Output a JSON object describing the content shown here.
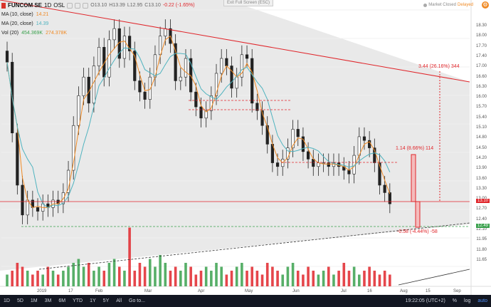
{
  "window": {
    "exit_fullscreen": "Exit Full Screen (ESC)"
  },
  "header": {
    "symbol": "FUNCOM SE",
    "interval": "1D",
    "exchange": "OSL",
    "ohlc": {
      "o_label": "O",
      "o": "13.10",
      "h_label": "H",
      "h": "13.39",
      "l_label": "L",
      "l": "12.95",
      "c_label": "C",
      "c": "13.10",
      "change": "-0.22 (-1.65%)"
    },
    "market_status": "Market Closed",
    "delayed": "Delayed"
  },
  "legend": [
    {
      "label": "MA (10, close)",
      "value": "14.21",
      "color": "#f08a24"
    },
    {
      "label": "MA (20, close)",
      "value": "14.39",
      "color": "#4fb3bf"
    },
    {
      "label": "Vol (20)",
      "value": "454.369K",
      "value2": "274.378K",
      "color": "#3aa14d",
      "color2": "#f08a24"
    }
  ],
  "price_axis": [
    "18.30",
    "18.00",
    "17.70",
    "17.40",
    "17.00",
    "16.60",
    "16.30",
    "16.00",
    "15.70",
    "15.40",
    "15.10",
    "14.80",
    "14.50",
    "14.20",
    "13.90",
    "13.60",
    "13.30",
    "13.00",
    "12.70",
    "12.40",
    "12.10",
    "11.95",
    "11.80",
    "11.65"
  ],
  "price_tags": [
    {
      "label": "13.10",
      "color": "#e0262b"
    },
    {
      "label": "12.49",
      "color": "#3aa14d"
    }
  ],
  "time_axis": [
    "2019",
    "17",
    "Feb",
    "Mar",
    "Apr",
    "May",
    "Jun",
    "Jul",
    "16",
    "Aug",
    "15",
    "Sep"
  ],
  "annotations": [
    {
      "text": "3.44 (26.16%) 344"
    },
    {
      "text": "1.14 (8.66%) 114"
    },
    {
      "text": "-0.58 (-4.44%) -58"
    }
  ],
  "bottom_bar": {
    "ranges": [
      "1D",
      "5D",
      "1M",
      "3M",
      "6M",
      "YTD",
      "1Y",
      "5Y",
      "All"
    ],
    "goto": "Go to...",
    "time": "19:22:05 (UTC+2)",
    "right": [
      "%",
      "log",
      "auto"
    ]
  },
  "chart_data": {
    "type": "candlestick",
    "ylim": [
      11.65,
      18.3
    ],
    "x": [
      "2019",
      "17",
      "Feb",
      "Mar",
      "Apr",
      "May",
      "Jun",
      "Jul",
      "16",
      "Aug"
    ],
    "close": [
      16.9,
      15.0,
      13.6,
      12.8,
      13.2,
      13.0,
      12.9,
      13.1,
      13.0,
      13.2,
      13.1,
      13.4,
      14.0,
      15.2,
      16.0,
      16.5,
      15.8,
      16.8,
      17.3,
      16.5,
      17.5,
      17.8,
      17.0,
      17.6,
      17.2,
      16.4,
      16.1,
      15.9,
      16.5,
      17.1,
      17.6,
      17.8,
      17.4,
      16.4,
      16.5,
      17.0,
      16.1,
      15.7,
      15.4,
      15.6,
      16.0,
      16.6,
      17.0,
      16.8,
      16.2,
      16.5,
      17.1,
      17.0,
      15.8,
      15.6,
      15.2,
      14.7,
      14.2,
      14.1,
      14.3,
      14.6,
      15.1,
      14.9,
      14.5,
      14.3,
      14.1,
      14.2,
      14.2,
      14.1,
      14.2,
      14.1,
      14.0,
      13.9,
      14.4,
      14.9,
      14.8,
      14.6,
      14.2,
      13.6,
      13.4,
      13.1
    ],
    "volume": [
      0.3,
      0.4,
      0.6,
      0.5,
      0.4,
      0.3,
      0.4,
      0.3,
      0.5,
      0.4,
      0.3,
      0.4,
      0.5,
      0.6,
      0.7,
      0.5,
      0.6,
      0.4,
      0.5,
      0.4,
      0.6,
      0.7,
      0.5,
      0.4,
      1.5,
      0.4,
      0.6,
      0.5,
      0.7,
      0.5,
      0.8,
      0.6,
      0.4,
      0.5,
      0.4,
      0.6,
      0.5,
      0.3,
      0.4,
      0.5,
      0.4,
      0.6,
      0.5,
      0.3,
      0.4,
      0.5,
      0.6,
      0.4,
      0.5,
      0.4,
      0.3,
      0.6,
      0.5,
      0.4,
      0.3,
      0.5,
      0.6,
      0.4,
      0.3,
      0.5,
      0.4,
      0.3,
      0.4,
      0.5,
      0.3,
      0.4,
      0.6,
      0.4,
      0.5,
      0.3,
      0.4,
      0.5,
      0.4,
      0.3,
      0.4,
      0.3
    ],
    "hlines": [
      15.7,
      15.47,
      14.1,
      13.1,
      12.49
    ],
    "trendline_top": [
      [
        0,
        18.7
      ],
      [
        1,
        16.4
      ]
    ],
    "trendline_bottom": [
      [
        0,
        11.5
      ],
      [
        1,
        12.5
      ]
    ]
  }
}
